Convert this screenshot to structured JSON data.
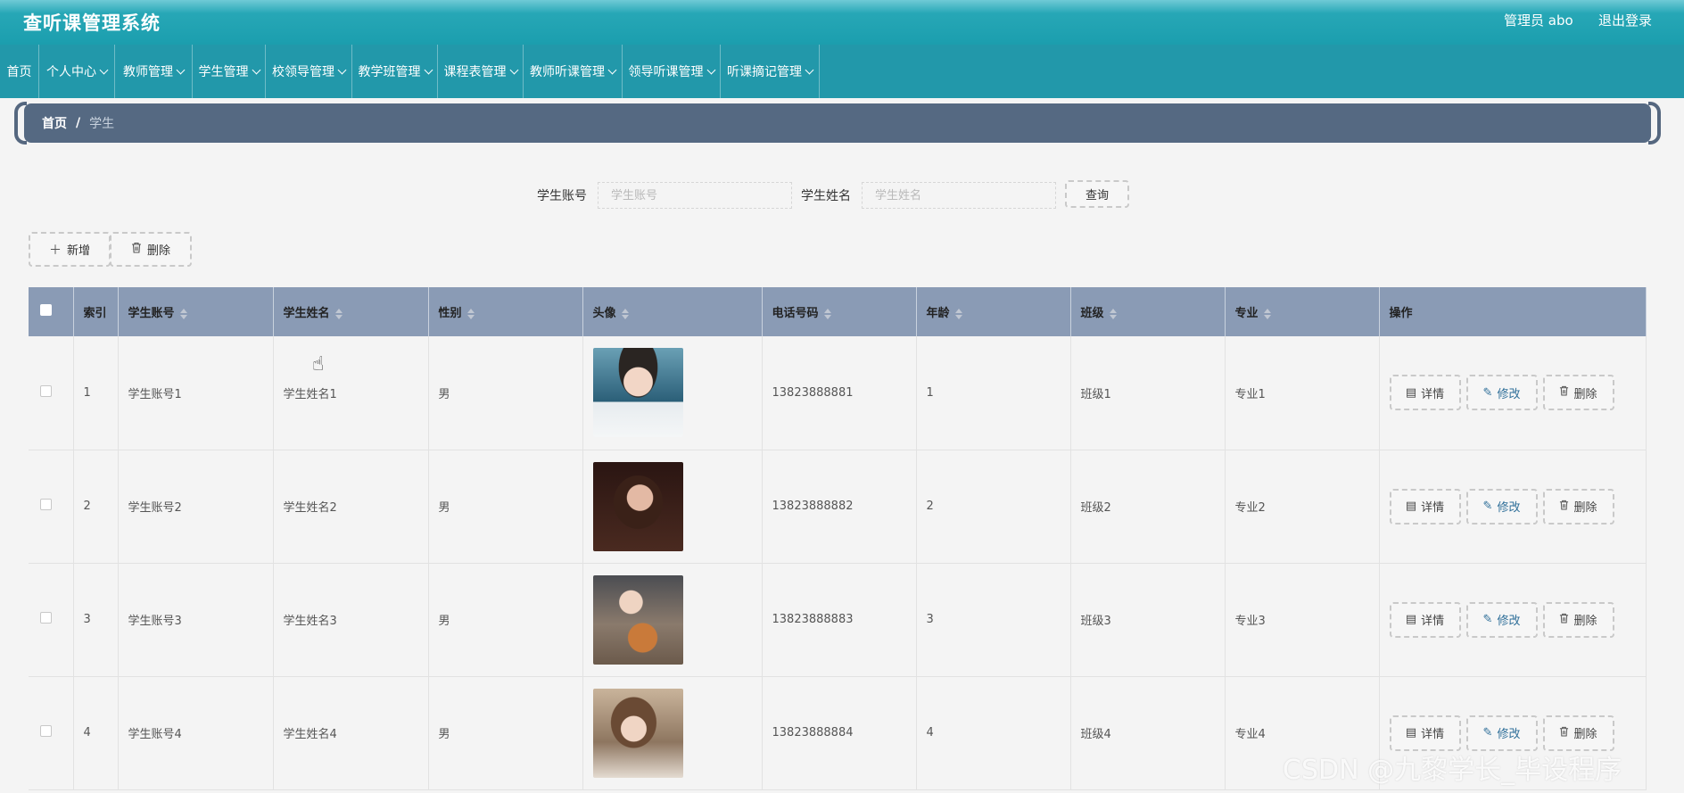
{
  "header": {
    "title": "查听课管理系统",
    "user_label": "管理员 abo",
    "logout_label": "退出登录"
  },
  "nav": {
    "items": [
      {
        "label": "首页",
        "has_dropdown": false
      },
      {
        "label": "个人中心",
        "has_dropdown": true
      },
      {
        "label": "教师管理",
        "has_dropdown": true
      },
      {
        "label": "学生管理",
        "has_dropdown": true
      },
      {
        "label": "校领导管理",
        "has_dropdown": true
      },
      {
        "label": "教学班管理",
        "has_dropdown": true
      },
      {
        "label": "课程表管理",
        "has_dropdown": true
      },
      {
        "label": "教师听课管理",
        "has_dropdown": true
      },
      {
        "label": "领导听课管理",
        "has_dropdown": true
      },
      {
        "label": "听课摘记管理",
        "has_dropdown": true
      }
    ]
  },
  "breadcrumb": {
    "home": "首页",
    "separator": "/",
    "current": "学生"
  },
  "search": {
    "account_label": "学生账号",
    "account_placeholder": "学生账号",
    "account_value": "",
    "name_label": "学生姓名",
    "name_placeholder": "学生姓名",
    "name_value": "",
    "query_label": "查询"
  },
  "actions": {
    "add_label": "新增",
    "delete_label": "删除"
  },
  "table": {
    "columns": [
      "索引",
      "学生账号",
      "学生姓名",
      "性别",
      "头像",
      "电话号码",
      "年龄",
      "班级",
      "专业",
      "操作"
    ],
    "rows": [
      {
        "index": "1",
        "account": "学生账号1",
        "name": "学生姓名1",
        "gender": "男",
        "avatar": "avatar-1",
        "phone": "13823888881",
        "age": "1",
        "class": "班级1",
        "major": "专业1"
      },
      {
        "index": "2",
        "account": "学生账号2",
        "name": "学生姓名2",
        "gender": "男",
        "avatar": "avatar-2",
        "phone": "13823888882",
        "age": "2",
        "class": "班级2",
        "major": "专业2"
      },
      {
        "index": "3",
        "account": "学生账号3",
        "name": "学生姓名3",
        "gender": "男",
        "avatar": "avatar-3",
        "phone": "13823888883",
        "age": "3",
        "class": "班级3",
        "major": "专业3"
      },
      {
        "index": "4",
        "account": "学生账号4",
        "name": "学生姓名4",
        "gender": "男",
        "avatar": "avatar-4",
        "phone": "13823888884",
        "age": "4",
        "class": "班级4",
        "major": "专业4"
      }
    ],
    "row_actions": {
      "detail": "详情",
      "edit": "修改",
      "delete": "删除"
    }
  },
  "watermark": "CSDN @九黎学长_毕设程序",
  "colors": {
    "header": "#1b9eae",
    "nav": "#2298aa",
    "breadcrumb": "#556982",
    "table_header": "#8a9bb5",
    "background": "#f4f4f4"
  }
}
